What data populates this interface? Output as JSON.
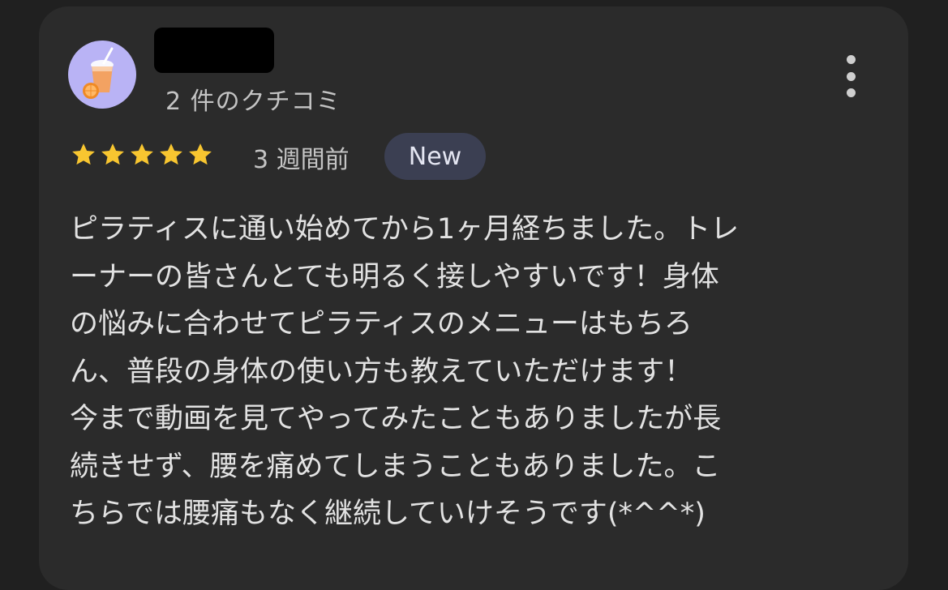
{
  "review": {
    "review_count": "2 件のクチコミ",
    "rating": 5,
    "rating_max": 5,
    "time_ago": "3 週間前",
    "badge": "New",
    "star_color": "#f8c630",
    "avatar_icon": "orange-juice-icon",
    "more_icon": "more-vert-icon",
    "text_lines": [
      "ピラティスに通い始めてから1ヶ月経ちました。トレ",
      "ーナーの皆さんとても明るく接しやすいです！身体",
      "の悩みに合わせてピラティスのメニューはもちろ",
      "ん、普段の身体の使い方も教えていただけます！",
      "今まで動画を見てやってみたこともありましたが長",
      "続きせず、腰を痛めてしまうこともありました。こ",
      "ちらでは腰痛もなく継続していけそうです(*^^*)"
    ]
  }
}
